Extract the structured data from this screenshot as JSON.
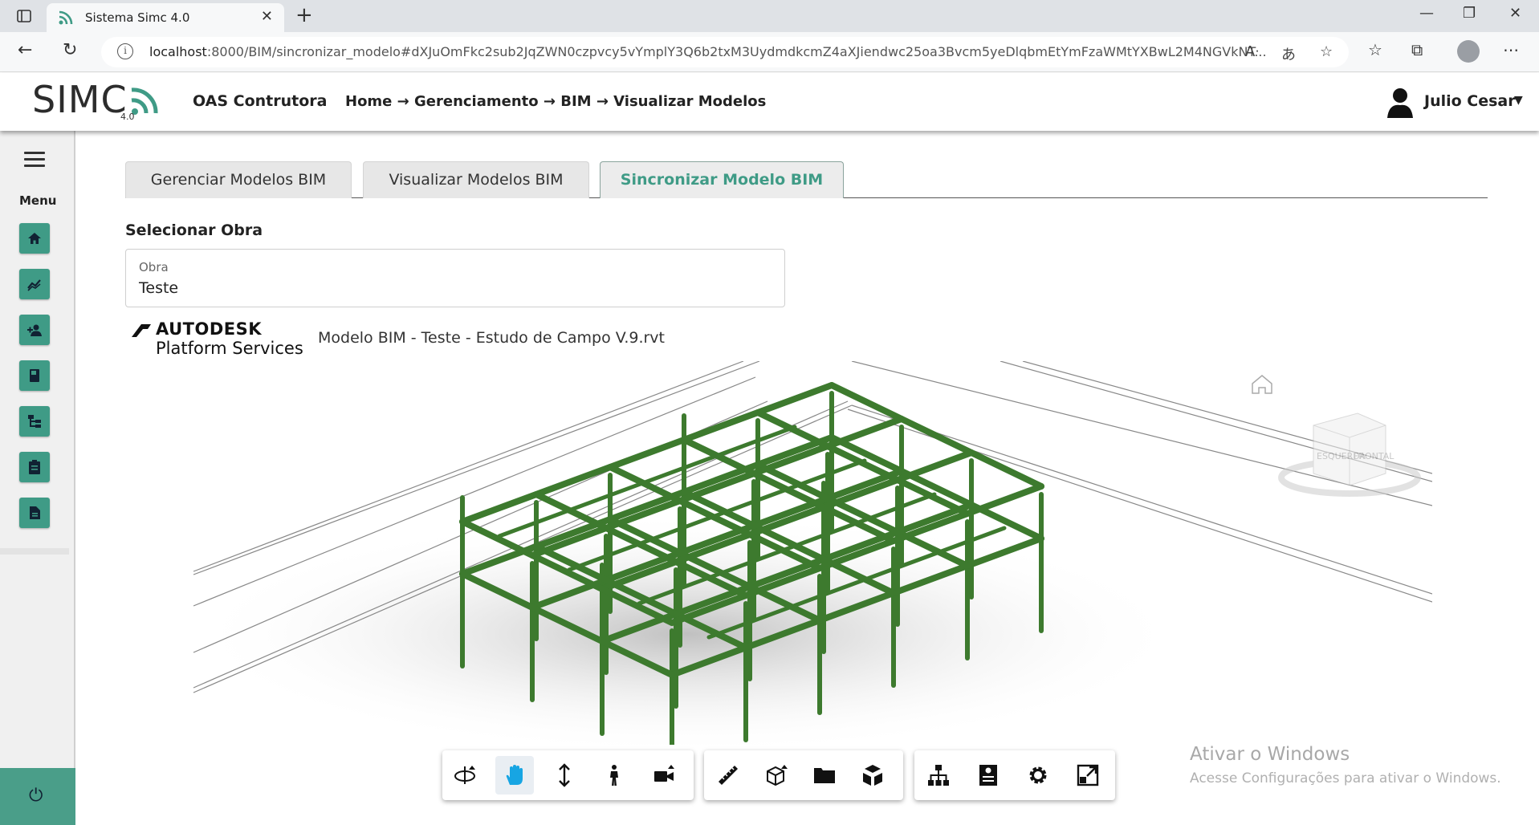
{
  "browser": {
    "tab_title": "Sistema Simc 4.0",
    "url_host": "localhost",
    "url_rest": ":8000/BIM/sincronizar_modelo#dXJuOmFkc2sub2JqZWN0czpvcy5vYmplY3Q6b2txM3UydmdkcmZ4aXJiendwc25oa3Bvcm5yeDlqbmEtYmFzaWMtYXBwL2M4NGVkNT..."
  },
  "header": {
    "logo_text": "SIMC",
    "logo_version": "4.0",
    "company": "OAS Contrutora",
    "breadcrumb": "Home → Gerenciamento → BIM → Visualizar Modelos",
    "user_name": "Julio Cesar"
  },
  "sidebar": {
    "menu_label": "Menu",
    "items": [
      {
        "icon": "home-icon"
      },
      {
        "icon": "chart-icon"
      },
      {
        "icon": "add-user-icon"
      },
      {
        "icon": "book-icon"
      },
      {
        "icon": "hierarchy-icon"
      },
      {
        "icon": "clipboard-icon"
      },
      {
        "icon": "document-icon"
      }
    ],
    "logout_icon": "power-icon"
  },
  "tabs": [
    {
      "label": "Gerenciar Modelos BIM",
      "active": false
    },
    {
      "label": "Visualizar Modelos BIM",
      "active": false
    },
    {
      "label": "Sincronizar Modelo BIM",
      "active": true
    }
  ],
  "select": {
    "title": "Selecionar Obra",
    "label": "Obra",
    "value": "Teste"
  },
  "viewer": {
    "brand_line1": "AUTODESK",
    "brand_line2": "Platform Services",
    "model_name": "Modelo BIM - Teste - Estudo de Campo V.9.rvt",
    "viewcube_labels": [
      "ESQUERDA",
      "FRONTAL"
    ],
    "model_color": "#3d7a2e",
    "toolbar_groups": [
      [
        "orbit-icon",
        "pan-icon",
        "zoom-icon",
        "first-person-icon",
        "camera-icon"
      ],
      [
        "measure-icon",
        "section-icon",
        "explode-icon",
        "model-browser-icon"
      ],
      [
        "structure-icon",
        "properties-icon",
        "settings-icon",
        "fullscreen-icon"
      ]
    ]
  },
  "watermark": {
    "line1": "Ativar o Windows",
    "line2": "Acesse Configurações para ativar o Windows."
  },
  "colors": {
    "accent": "#3f9b86",
    "active_tab_text": "#3f9b86"
  }
}
